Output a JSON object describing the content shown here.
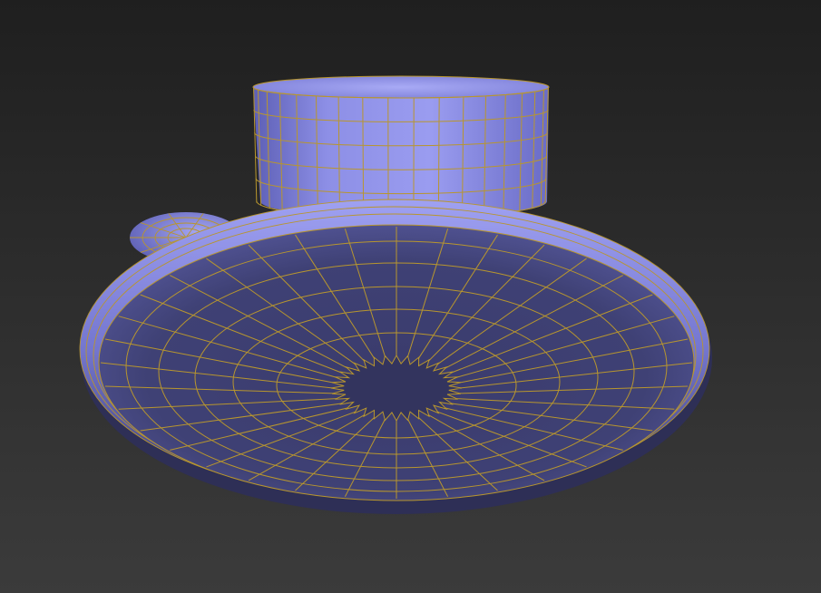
{
  "viewport": {
    "background_top": "#1f1f1f",
    "background_bottom": "#3b3b3b",
    "shading_mode": "smooth-shaded-with-edged-faces"
  },
  "model": {
    "object": "suction-cup",
    "base_color": "#8f90e6",
    "underside_color": "#3b3c70",
    "wire_color": "#b8962e",
    "radial_segments": 36,
    "cap_height_segments": 5
  }
}
